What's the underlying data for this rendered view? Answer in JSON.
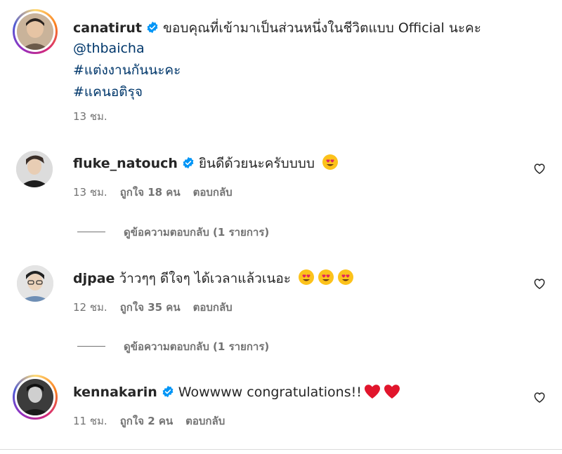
{
  "caption": {
    "username": "canatirut",
    "text": "ขอบคุณที่เข้ามาเป็นส่วนหนึ่งในชีวิตแบบ Official นะคะ",
    "mention": "@thbaicha",
    "hashtags": [
      "#แต่งงานกันนะคะ",
      "#แคนอติรุจ"
    ],
    "time": "13 ชม."
  },
  "comments": [
    {
      "username": "fluke_natouch",
      "verified": true,
      "text": "ยินดีด้วยนะครับบบบ",
      "emojis": [
        "heart-eyes"
      ],
      "time": "13 ชม.",
      "likes": "ถูกใจ 18 คน",
      "reply_label": "ตอบกลับ",
      "view_replies": "ดูข้อความตอบกลับ (1 รายการ)"
    },
    {
      "username": "djpae",
      "verified": false,
      "text": "ว้าวๆๆ ดีใจๆ ได้เวลาแล้วเนอะ",
      "emojis": [
        "heart-eyes",
        "heart-eyes",
        "heart-eyes"
      ],
      "time": "12 ชม.",
      "likes": "ถูกใจ 35 คน",
      "reply_label": "ตอบกลับ",
      "view_replies": "ดูข้อความตอบกลับ (1 รายการ)"
    },
    {
      "username": "kennakarin",
      "verified": true,
      "text": "Wowwww congratulations!!",
      "emojis": [
        "red-heart",
        "red-heart"
      ],
      "time": "11 ชม.",
      "likes": "ถูกใจ 2 คน",
      "reply_label": "ตอบกลับ"
    }
  ],
  "colors": {
    "text": "#262626",
    "secondary": "#737373",
    "link": "#00376b",
    "verified": "#0095f6"
  }
}
